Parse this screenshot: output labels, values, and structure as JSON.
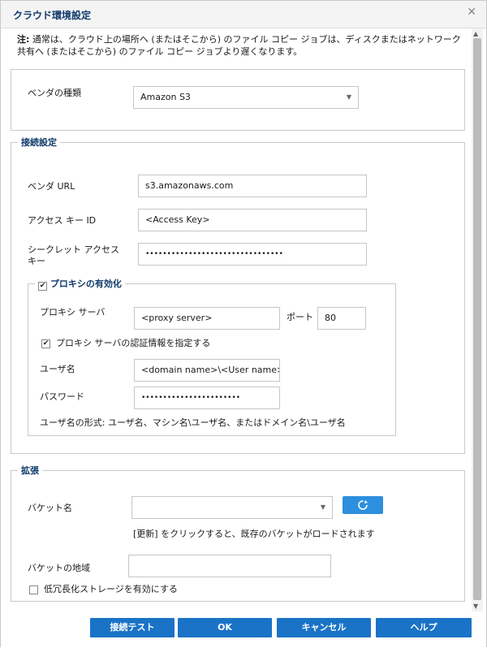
{
  "dialog": {
    "title": "クラウド環境設定"
  },
  "note": {
    "prefix": "注:",
    "text": "通常は、クラウド上の場所へ (またはそこから) のファイル コピー ジョブは、ディスクまたはネットワーク共有へ (またはそこから) のファイル コピー ジョブより遅くなります。"
  },
  "vendor": {
    "label": "ベンダの種類",
    "value": "Amazon S3"
  },
  "connection": {
    "legend": "接続設定",
    "vendor_url_label": "ベンダ URL",
    "vendor_url_value": "s3.amazonaws.com",
    "access_key_label": "アクセス キー ID",
    "access_key_value": "<Access Key>",
    "secret_key_label": "シークレット アクセス キー",
    "secret_key_value": "••••••••••••••••••••••••••••••••"
  },
  "proxy": {
    "legend": "プロキシの有効化",
    "enabled": true,
    "server_label": "プロキシ サーバ",
    "server_value": "<proxy server>",
    "port_label": "ポート",
    "port_value": "80",
    "auth_label": "プロキシ サーバの認証情報を指定する",
    "auth_checked": true,
    "user_label": "ユーザ名",
    "user_value": "<domain name>\\<User name>",
    "password_label": "パスワード",
    "password_value": "•••••••••••••••••••••••",
    "format_hint": "ユーザ名の形式: ユーザ名、マシン名\\ユーザ名、またはドメイン名\\ユーザ名"
  },
  "extension": {
    "legend": "拡張",
    "bucket_label": "バケット名",
    "bucket_value": "",
    "refresh_hint": "[更新] をクリックすると、既存のバケットがロードされます",
    "region_label": "バケットの地域",
    "region_value": "",
    "rrs_label": "低冗長化ストレージを有効にする",
    "rrs_checked": false
  },
  "buttons": {
    "test": "接続テスト",
    "ok": "OK",
    "cancel": "キャンセル",
    "help": "ヘルプ"
  },
  "colors": {
    "accent": "#1a73c7",
    "title": "#0f3a6b"
  }
}
